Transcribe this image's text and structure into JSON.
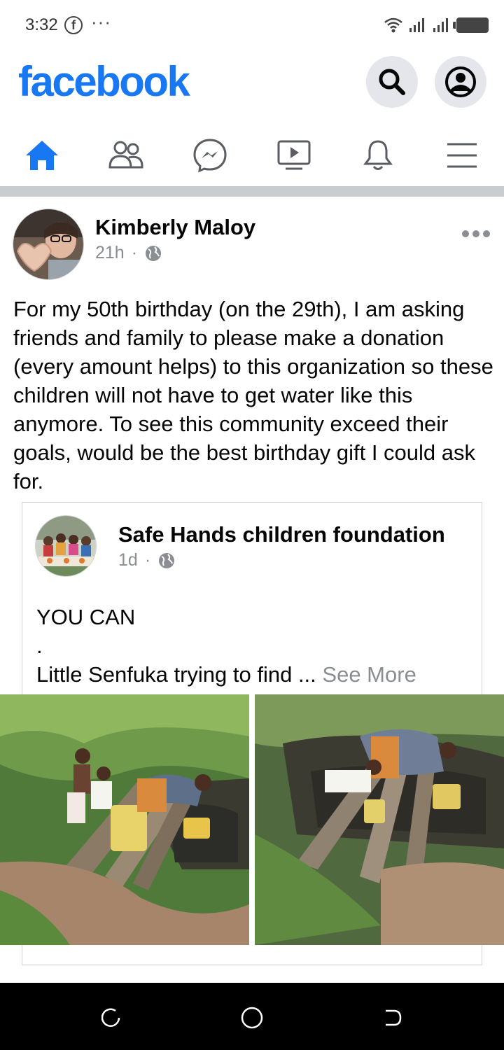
{
  "status_bar": {
    "time": "3:32",
    "fb_glyph": "f",
    "dots": "···"
  },
  "header": {
    "logo": "facebook",
    "brand_color": "#1877f2"
  },
  "nav": {
    "tabs": [
      {
        "name": "home-icon",
        "active": true
      },
      {
        "name": "friends-icon",
        "active": false
      },
      {
        "name": "messenger-icon",
        "active": false
      },
      {
        "name": "watch-icon",
        "active": false
      },
      {
        "name": "notifications-icon",
        "active": false
      },
      {
        "name": "menu-icon",
        "active": false
      }
    ]
  },
  "post": {
    "author": "Kimberly Maloy",
    "time": "21h",
    "separator": "·",
    "text": "For my 50th birthday (on the 29th), I am asking friends and family to please make a donation (every amount helps) to this organization so these children will not have to get water like this anymore. To see this community exceed their goals, would be the best birthday gift I could ask for."
  },
  "shared": {
    "name": "Safe Hands children foundation",
    "time": "1d",
    "separator": "·",
    "line1": "YOU CAN",
    "line2": ".",
    "line3": "Little Senfuka trying to find ...",
    "see_more": "See More"
  }
}
